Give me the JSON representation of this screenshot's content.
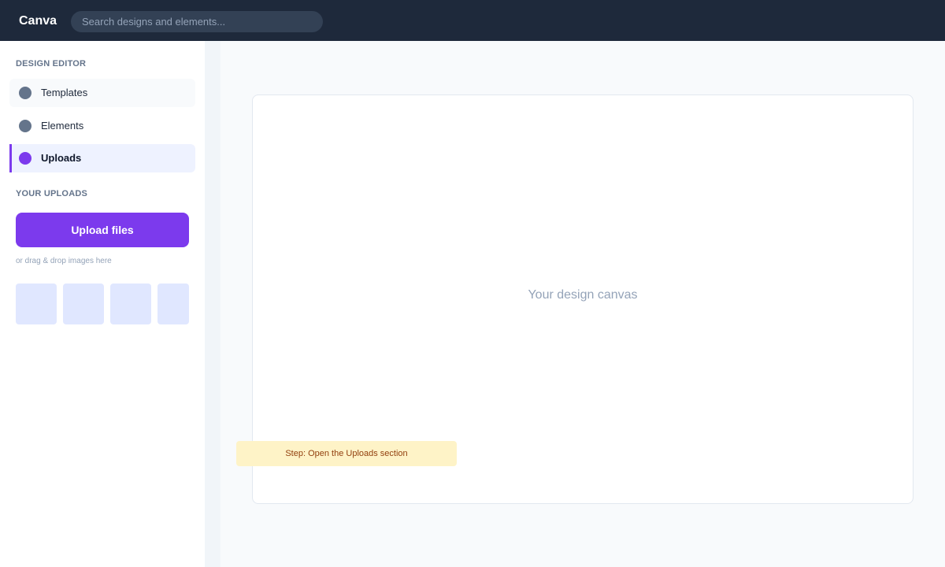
{
  "app": {
    "name": "Canva"
  },
  "search": {
    "placeholder": "Search designs and elements..."
  },
  "sidebar": {
    "section_heading": "DESIGN EDITOR",
    "items": [
      {
        "label": "Templates",
        "icon": "templates-icon",
        "state": "hovered"
      },
      {
        "label": "Elements",
        "icon": "elements-icon",
        "state": "default"
      },
      {
        "label": "Uploads",
        "icon": "uploads-icon",
        "state": "active"
      }
    ],
    "uploads": {
      "heading": "YOUR UPLOADS",
      "button_label": "Upload files",
      "hint": "or drag & drop images here",
      "thumbnail_count": 4
    }
  },
  "canvas": {
    "placeholder_text": "Your design canvas"
  },
  "step_banner": {
    "text": "Step: Open the Uploads section"
  },
  "colors": {
    "topbar": "#1e293b",
    "accent": "#7c3aed",
    "active_item_bg": "#eef2ff",
    "thumbnail": "#e0e7ff",
    "banner_bg": "#fef3c7",
    "banner_text": "#92400e"
  }
}
